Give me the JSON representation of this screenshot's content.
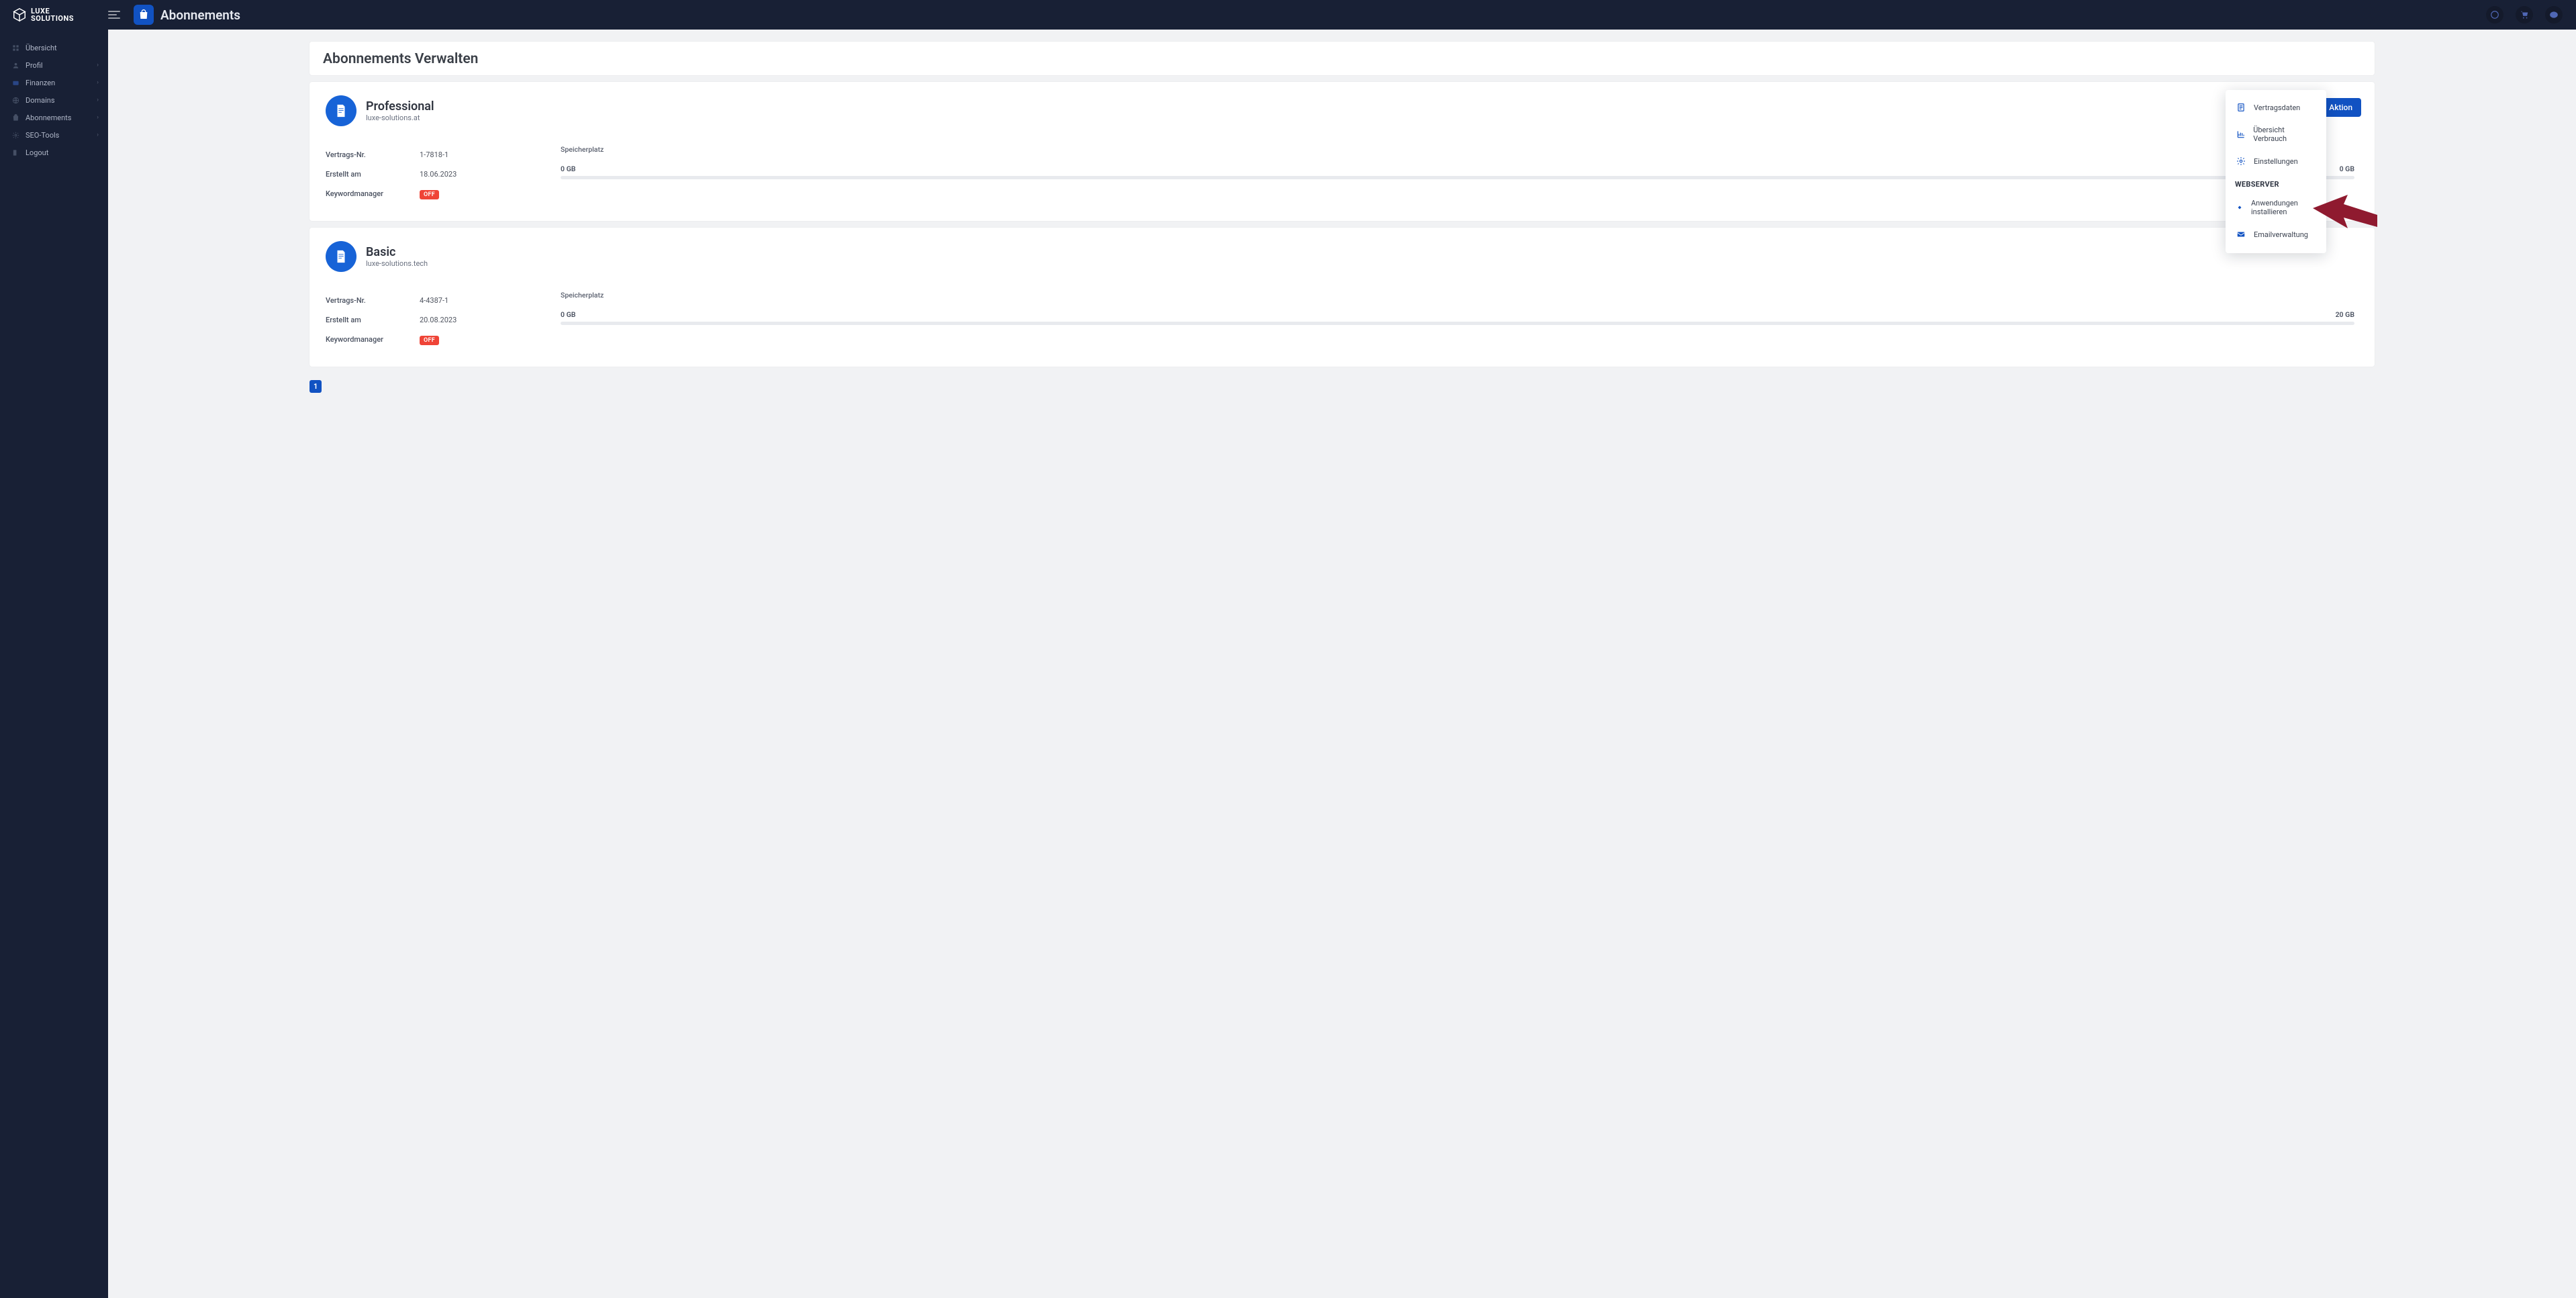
{
  "brand": {
    "name1": "LUXE",
    "name2": "SOLUTIONS"
  },
  "page_title": "Abonnements",
  "panel_title": "Abonnements Verwalten",
  "sidebar": {
    "items": [
      {
        "label": "Übersicht",
        "icon": "grid",
        "expandable": false
      },
      {
        "label": "Profil",
        "icon": "user",
        "expandable": true
      },
      {
        "label": "Finanzen",
        "icon": "wallet",
        "expandable": true
      },
      {
        "label": "Domains",
        "icon": "globe",
        "expandable": true
      },
      {
        "label": "Abonnements",
        "icon": "bag",
        "expandable": true
      },
      {
        "label": "SEO-Tools",
        "icon": "gear",
        "expandable": true
      },
      {
        "label": "Logout",
        "icon": "exit",
        "expandable": false
      }
    ]
  },
  "labels": {
    "contract_no": "Vertrags-Nr.",
    "created_at": "Erstellt am",
    "keyword_manager": "Keywordmanager",
    "storage": "Speicherplatz",
    "off": "OFF",
    "action": "Aktion"
  },
  "subscriptions": [
    {
      "name": "Professional",
      "domain": "luxe-solutions.at",
      "contract_no": "1-7818-1",
      "created_at": "18.06.2023",
      "keyword_manager": "OFF",
      "storage_used": "0 GB",
      "storage_total": "0 GB"
    },
    {
      "name": "Basic",
      "domain": "luxe-solutions.tech",
      "contract_no": "4-4387-1",
      "created_at": "20.08.2023",
      "keyword_manager": "OFF",
      "storage_used": "0 GB",
      "storage_total": "20 GB"
    }
  ],
  "action_menu": {
    "items_top": [
      {
        "label": "Vertragsdaten",
        "icon": "document"
      },
      {
        "label": "Übersicht Verbrauch",
        "icon": "chart"
      },
      {
        "label": "Einstellungen",
        "icon": "settings"
      }
    ],
    "section": "WEBSERVER",
    "items_bottom": [
      {
        "label": "Anwendungen installieren",
        "icon": "apps"
      },
      {
        "label": "Emailverwaltung",
        "icon": "email"
      }
    ]
  },
  "pagination": {
    "current": "1"
  },
  "colors": {
    "primary": "#1152c2",
    "dark": "#182035",
    "danger": "#ef4437",
    "arrow": "#8f1a2f"
  }
}
